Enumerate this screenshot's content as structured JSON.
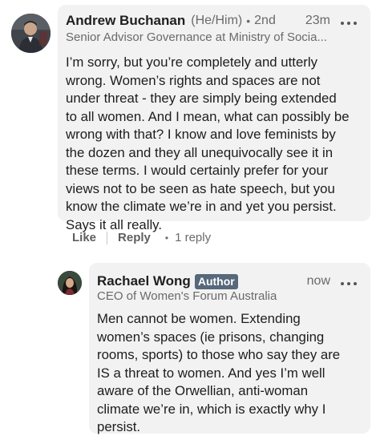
{
  "main_comment": {
    "author": "Andrew Buchanan",
    "pronouns": "(He/Him)",
    "degree": "2nd",
    "time": "23m",
    "headline": "Senior Advisor Governance at Ministry of Socia...",
    "body": "I’m sorry, but you’re completely and utterly\nwrong. Women’s rights and spaces are not\nunder threat - they are simply being extended\nto all women. And I mean, what can possibly be\nwrong with that? I know and love feminists by\nthe dozen and they all unequivocally see it in\nthese terms. I would certainly prefer for your\nviews not to be seen as hate speech, but you\nknow the climate we’re in and yet you persist.\nSays it all really."
  },
  "actions": {
    "like_label": "Like",
    "reply_label": "Reply",
    "replies_count": "1 reply"
  },
  "reply_comment": {
    "author": "Rachael Wong",
    "badge": "Author",
    "time": "now",
    "headline": "CEO of Women's Forum Australia",
    "body": "Men cannot be women. Extending\nwomen’s spaces (ie prisons, changing\nrooms, sports) to those who say they are\nIS a threat to women. And yes I’m well\naware of the Orwellian, anti-woman\nclimate we’re in, which is exactly why I\npersist."
  },
  "icons": {
    "more": "more-horizontal-icon",
    "separator": "dot-separator"
  },
  "colors": {
    "bubble_background": "#f2f2f2",
    "author_badge": "#56687a",
    "secondary_text": "#6a6a6a"
  }
}
